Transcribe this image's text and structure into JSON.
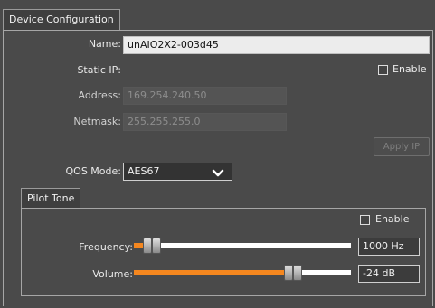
{
  "device_config": {
    "title": "Device Configuration",
    "name_label": "Name:",
    "name_value": "unAIO2X2-003d45",
    "static_ip_label": "Static IP:",
    "enable_label": "Enable",
    "enable_checked": false,
    "address_label": "Address:",
    "address_value": "169.254.240.50",
    "netmask_label": "Netmask:",
    "netmask_value": "255.255.255.0",
    "apply_ip_label": "Apply IP",
    "qos_label": "QOS Mode:",
    "qos_value": "AES67"
  },
  "pilot_tone": {
    "title": "Pilot Tone",
    "enable_label": "Enable",
    "enable_checked": false,
    "frequency_label": "Frequency:",
    "frequency_value": "1000 Hz",
    "frequency_level": 0.08,
    "volume_label": "Volume:",
    "volume_value": "-24 dB",
    "volume_level": 0.73
  },
  "colors": {
    "accent": "#f5871f",
    "panel": "#4a4a4a"
  }
}
